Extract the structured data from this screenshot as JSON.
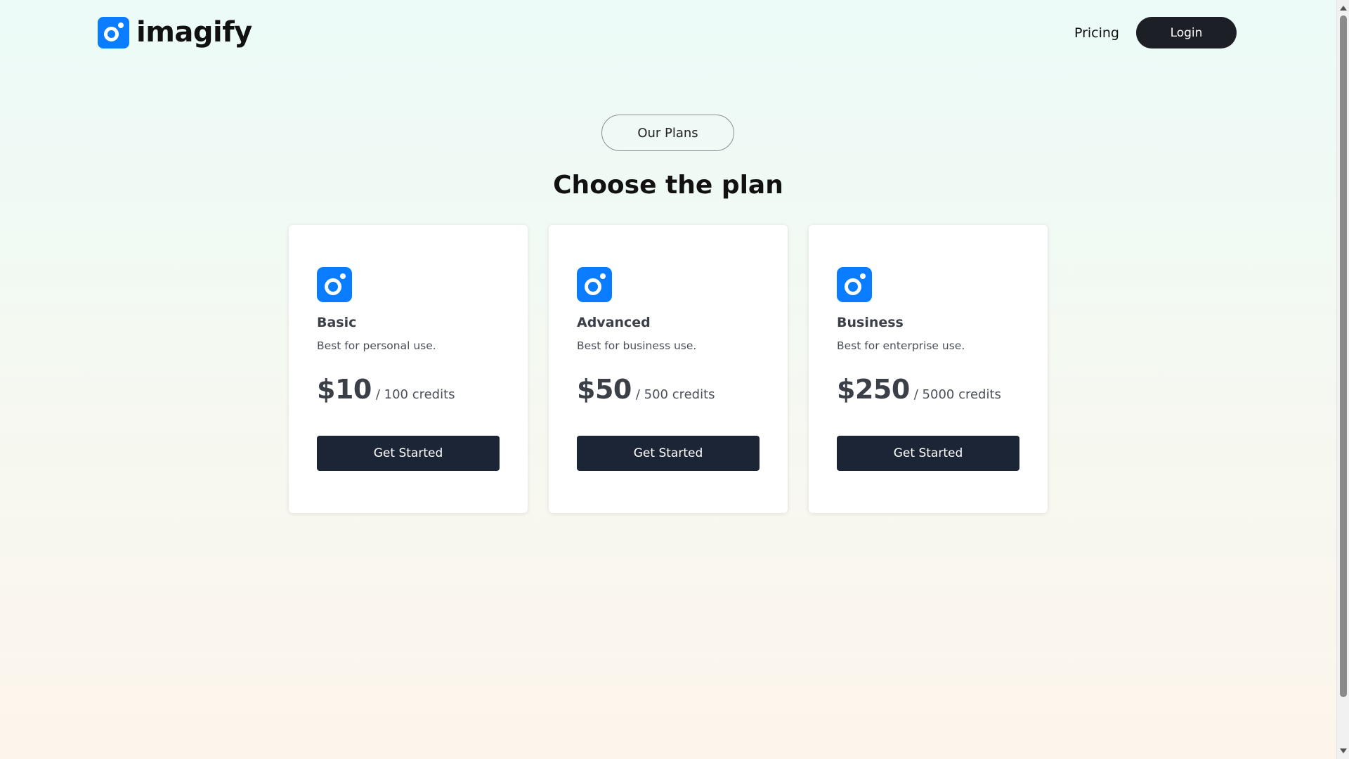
{
  "header": {
    "logo_text": "imagify",
    "logo_icon": "imagify-logo-icon",
    "nav": {
      "pricing_label": "Pricing",
      "login_label": "Login"
    }
  },
  "hero": {
    "pill_label": "Our Plans",
    "heading": "Choose the plan"
  },
  "plans": [
    {
      "name": "Basic",
      "description": "Best for personal use.",
      "price": "$10",
      "credits": "/ 100 credits",
      "button_label": "Get Started",
      "icon": "imagify-logo-icon"
    },
    {
      "name": "Advanced",
      "description": "Best for business use.",
      "price": "$50",
      "credits": "/ 500 credits",
      "button_label": "Get Started",
      "icon": "imagify-logo-icon"
    },
    {
      "name": "Business",
      "description": "Best for enterprise use.",
      "price": "$250",
      "credits": "/ 5000 credits",
      "button_label": "Get Started",
      "icon": "imagify-logo-icon"
    }
  ],
  "colors": {
    "brand_blue": "#0a7cff",
    "dark_button": "#1c2535",
    "login_button": "#1c1f26"
  }
}
